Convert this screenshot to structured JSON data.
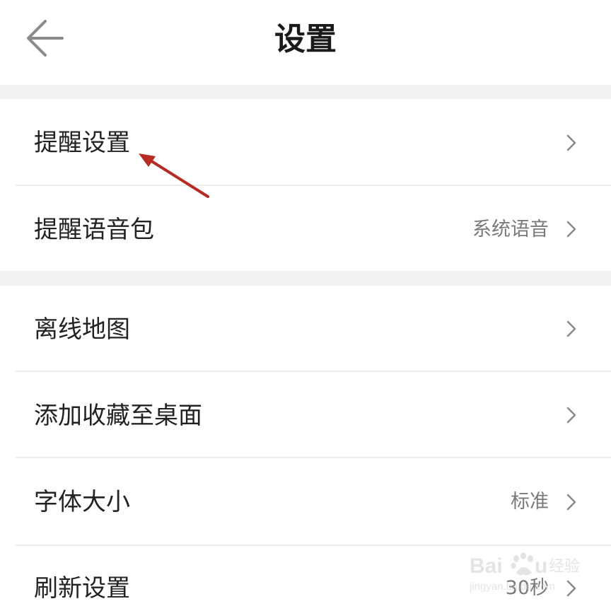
{
  "header": {
    "title": "设置",
    "back_icon": "back-arrow-icon"
  },
  "settings": {
    "reminder_settings": {
      "label": "提醒设置",
      "value": ""
    },
    "voice_pack": {
      "label": "提醒语音包",
      "value": "系统语音"
    },
    "offline_map": {
      "label": "离线地图",
      "value": ""
    },
    "add_favorites": {
      "label": "添加收藏至桌面",
      "value": ""
    },
    "font_size": {
      "label": "字体大小",
      "value": "标准"
    },
    "refresh_settings": {
      "label": "刷新设置",
      "value": "30秒"
    }
  },
  "icons": {
    "chevron": "chevron-right-icon"
  },
  "annotation": {
    "arrow_color": "#b82a22"
  },
  "watermark": {
    "text": "Baidu 经验",
    "url": "jingyan.baidu.com"
  },
  "colors": {
    "background": "#ffffff",
    "section_gap": "#f2f2f2",
    "divider": "#ececec",
    "label_text": "#222222",
    "value_text": "#7a7a7a"
  }
}
